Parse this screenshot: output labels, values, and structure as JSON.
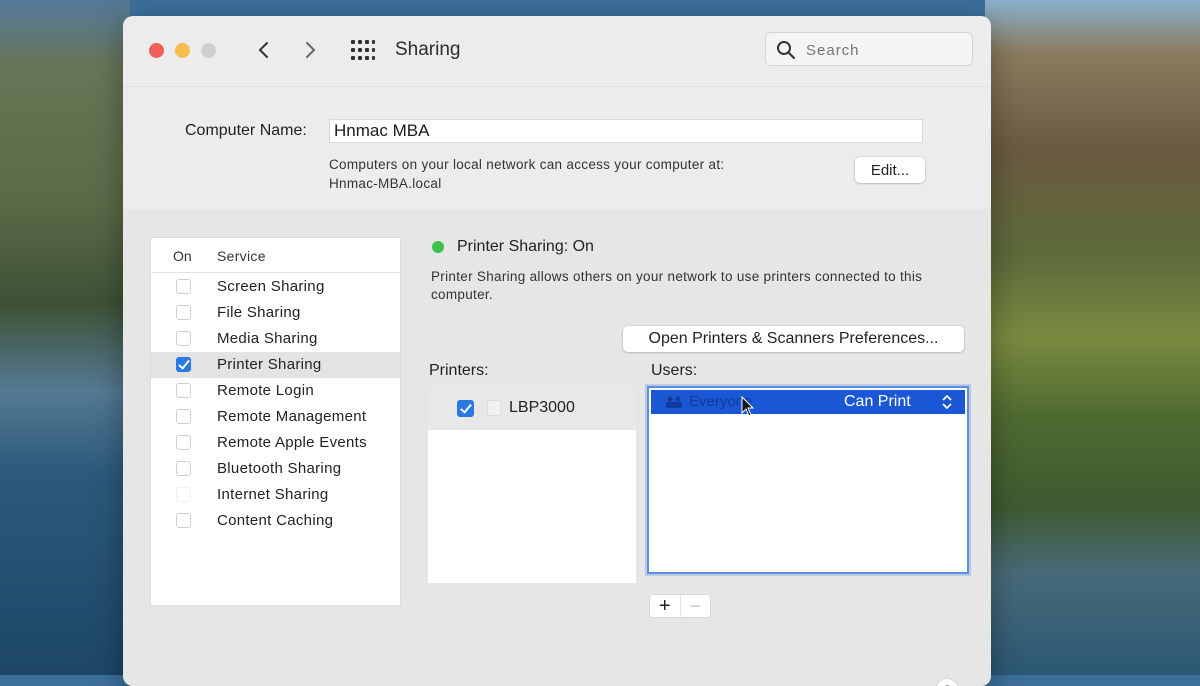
{
  "window": {
    "title": "Sharing",
    "search_placeholder": "Search",
    "back_icon": "chevron-left-icon",
    "forward_icon": "chevron-right-icon",
    "grid_icon": "show-all-grid-icon"
  },
  "computer_name": {
    "label": "Computer Name:",
    "value": "Hnmac MBA",
    "description_line1": "Computers on your local network can access your computer at:",
    "description_line2": "Hnmac-MBA.local",
    "edit_label": "Edit..."
  },
  "services": {
    "header_on": "On",
    "header_service": "Service",
    "items": [
      {
        "label": "Screen Sharing",
        "checked": false
      },
      {
        "label": "File Sharing",
        "checked": false
      },
      {
        "label": "Media Sharing",
        "checked": false
      },
      {
        "label": "Printer Sharing",
        "checked": true,
        "selected": true
      },
      {
        "label": "Remote Login",
        "checked": false
      },
      {
        "label": "Remote Management",
        "checked": false
      },
      {
        "label": "Remote Apple Events",
        "checked": false
      },
      {
        "label": "Bluetooth Sharing",
        "checked": false
      },
      {
        "label": "Internet Sharing",
        "checked": false
      },
      {
        "label": "Content Caching",
        "checked": false
      }
    ]
  },
  "detail": {
    "status_title": "Printer Sharing: On",
    "status_color": "#3cc14b",
    "description": "Printer Sharing allows others on your network to use printers connected to this computer.",
    "open_prefs_label": "Open Printers & Scanners Preferences...",
    "printers_label": "Printers:",
    "users_label": "Users:",
    "printers": [
      {
        "name": "LBP3000",
        "checked": true
      }
    ],
    "users": [
      {
        "name": "Everyone",
        "permission": "Can Print"
      }
    ],
    "add_label": "+",
    "remove_label": "−",
    "help_label": "?"
  },
  "colors": {
    "accent": "#2a78e4",
    "selection": "#1b57d4"
  }
}
